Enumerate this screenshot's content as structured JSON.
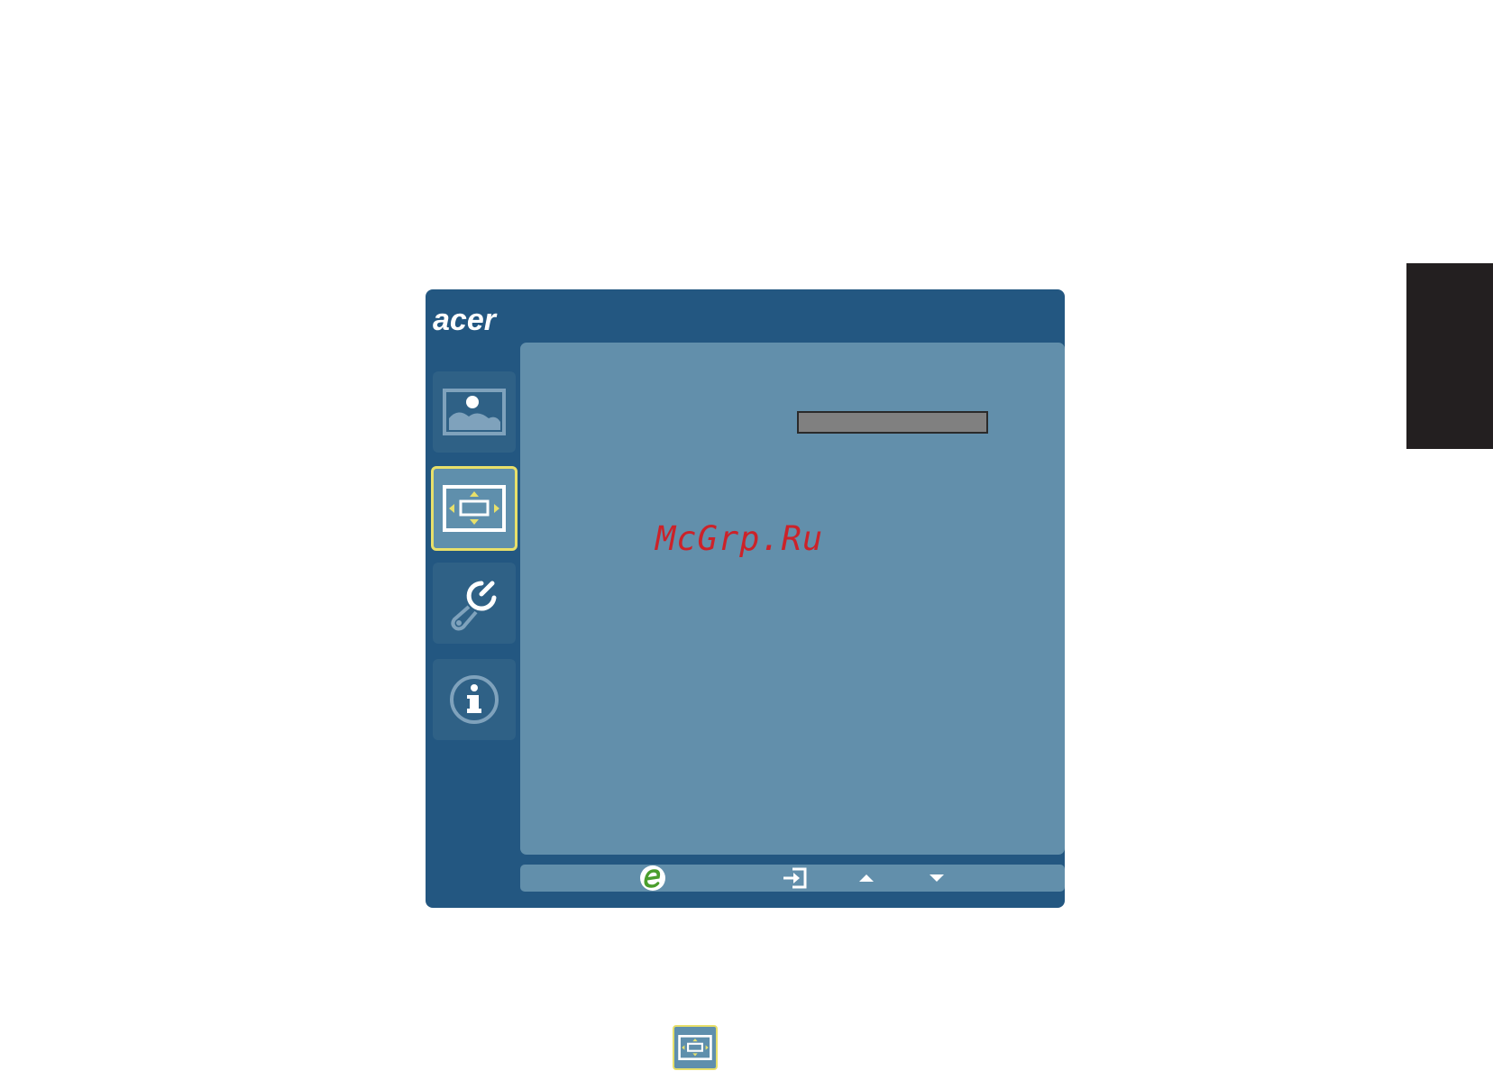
{
  "brand": {
    "logo_text": "acer"
  },
  "sidebar": {
    "items": [
      {
        "id": "picture",
        "icon": "picture-icon",
        "active": false
      },
      {
        "id": "display",
        "icon": "display-size-icon",
        "active": true
      },
      {
        "id": "settings",
        "icon": "wrench-icon",
        "active": false
      },
      {
        "id": "information",
        "icon": "info-icon",
        "active": false
      }
    ]
  },
  "content": {
    "slider_value": "",
    "watermark": "McGrp.Ru"
  },
  "bottom_bar": {
    "buttons": [
      {
        "icon": "e-eco-icon"
      },
      {
        "icon": "enter-icon"
      },
      {
        "icon": "arrow-up-icon"
      },
      {
        "icon": "arrow-down-icon"
      }
    ]
  },
  "colors": {
    "osd_background": "#235781",
    "content_panel": "#628fab",
    "active_border": "#e8e06a",
    "watermark": "#cc2229",
    "side_tab": "#231f20"
  }
}
